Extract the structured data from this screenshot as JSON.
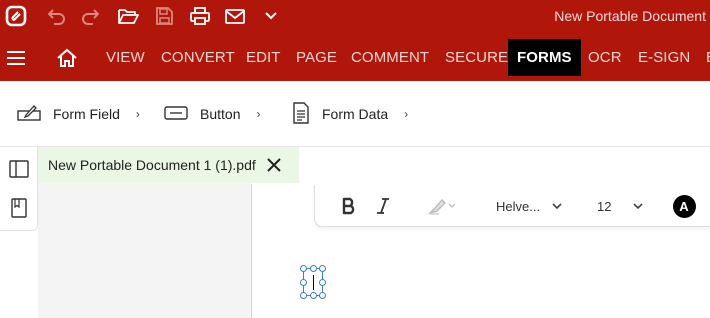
{
  "window": {
    "title": "New Portable Document"
  },
  "quick_access": [
    {
      "name": "undo-icon"
    },
    {
      "name": "redo-icon"
    },
    {
      "name": "open-folder-icon"
    },
    {
      "name": "save-icon"
    },
    {
      "name": "print-icon"
    },
    {
      "name": "email-icon"
    },
    {
      "name": "customize-chevron-icon"
    }
  ],
  "menu": {
    "items": [
      "VIEW",
      "CONVERT",
      "EDIT",
      "PAGE",
      "COMMENT",
      "SECURE",
      "FORMS",
      "OCR",
      "E-SIGN",
      "E"
    ],
    "active": "FORMS"
  },
  "ribbon": {
    "form_field": "Form Field",
    "button": "Button",
    "form_data": "Form Data"
  },
  "tab": {
    "label": "New Portable Document 1 (1).pdf"
  },
  "format_bar": {
    "font": "Helve...",
    "size": "12",
    "color_label": "A"
  },
  "colors": {
    "brand": "#b1160b",
    "active_tab": "#000000",
    "tab_background": "#eaf7e4",
    "selection": "#3b7fd1"
  }
}
